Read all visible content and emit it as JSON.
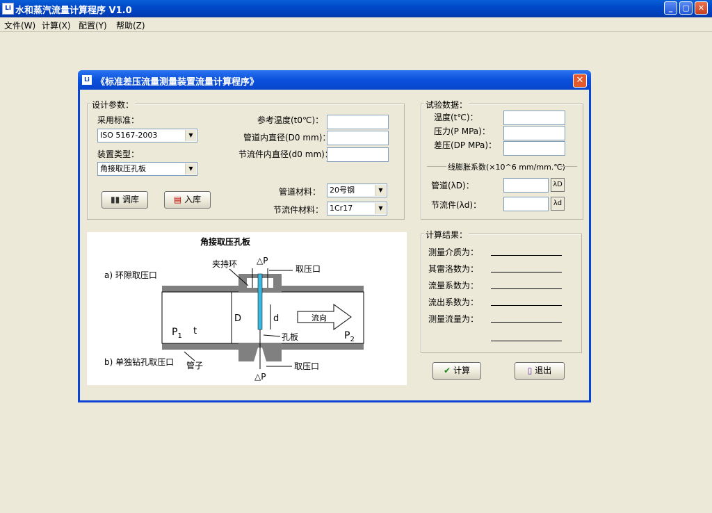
{
  "app": {
    "title": "水和蒸汽流量计算程序 V1.0",
    "logo": "Li"
  },
  "menu": [
    "文件(W)",
    "计算(X)",
    "配置(Y)",
    "帮助(Z)"
  ],
  "window_controls": {
    "minimize": "_",
    "maximize": "▢",
    "close": "✕"
  },
  "dialog": {
    "title": "《标准差压流量测量装置流量计算程序》",
    "close": "✕",
    "design": {
      "legend": "设计参数：",
      "standard_label": "采用标准：",
      "standard_value": "ISO 5167-2003",
      "device_label": "装置类型：",
      "device_value": "角接取压孔板",
      "ref_temp_label": "参考温度(t0℃)：",
      "pipe_dia_label": "管道内直径(D0 mm)：",
      "throttle_dia_label": "节流件内直径(d0 mm)：",
      "pipe_material_label": "管道材料：",
      "pipe_material_value": "20号钢",
      "throttle_material_label": "节流件材料：",
      "throttle_material_value": "1Cr17",
      "load_button": "调库",
      "save_button": "入库"
    },
    "test": {
      "legend": "试验数据：",
      "temp_label": "温度(t℃)：",
      "pressure_label": "压力(P MPa)：",
      "dp_label": "差压(DP MPa)：",
      "expansion_title": "线膨胀系数(×10^6 mm/mm.℃)",
      "pipe_label": "管道(λD)：",
      "pipe_btn": "λD",
      "throttle_label": "节流件(λd)：",
      "throttle_btn": "λd"
    },
    "result": {
      "legend": "计算结果：",
      "items": [
        "测量介质为：",
        "其雷洛数为：",
        "流量系数为：",
        "流出系数为：",
        "测量流量为："
      ]
    },
    "calc_button": "计算",
    "exit_button": "退出",
    "diagram": {
      "title": "角接取压孔板",
      "a_label": "a) 环隙取压口",
      "b_label": "b) 单独钻孔取压口",
      "clamp": "夹持环",
      "tap_top": "取压口",
      "tap_bottom": "取压口",
      "dp_top": "△P",
      "dp_bottom": "△P",
      "D": "D",
      "d": "d",
      "flow": "流向",
      "orifice": "孔板",
      "pipe": "管子",
      "p1": "P",
      "p1_sub": "1",
      "t": "t",
      "p2": "P",
      "p2_sub": "2"
    }
  }
}
